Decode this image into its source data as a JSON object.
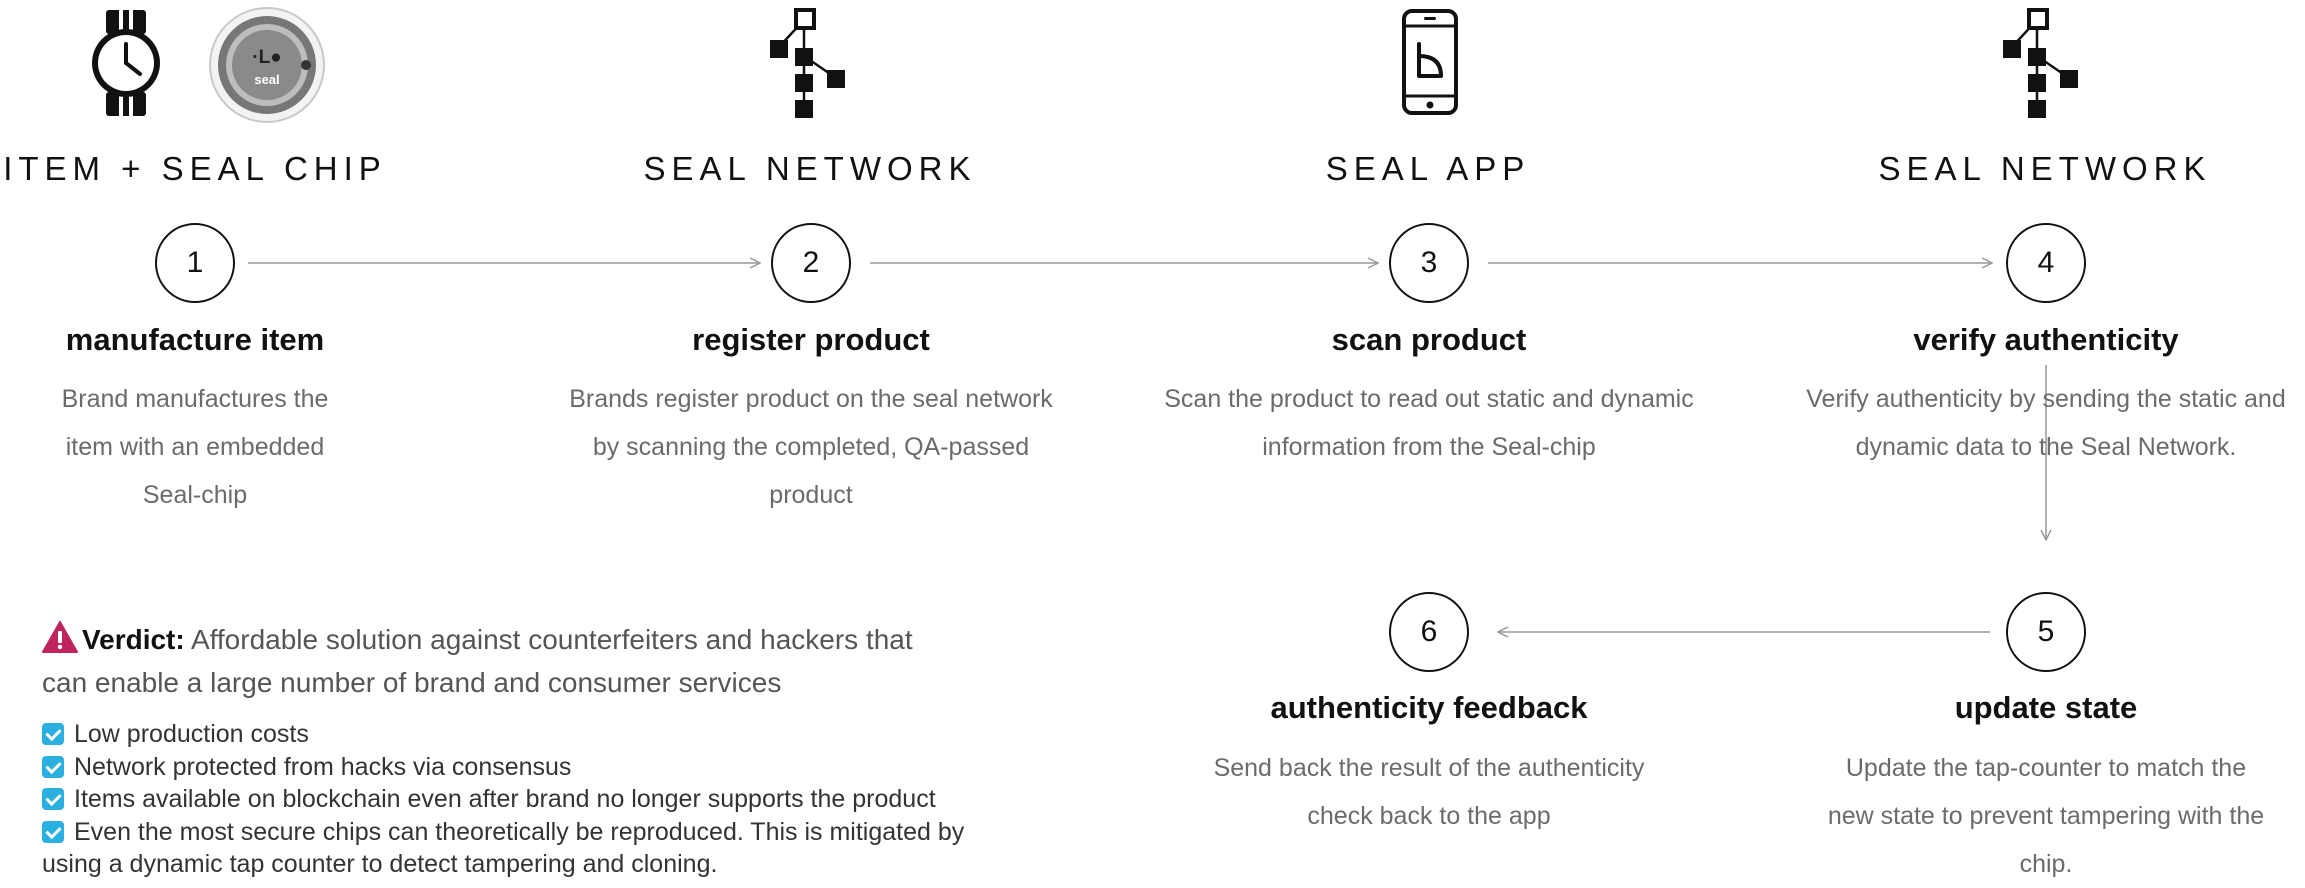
{
  "headers": [
    "ITEM + SEAL CHIP",
    "SEAL NETWORK",
    "SEAL APP",
    "SEAL NETWORK"
  ],
  "seal_logo_text": "seal",
  "steps": [
    {
      "number": "1",
      "title": "manufacture item",
      "desc": "Brand manufactures the item with an embedded Seal-chip"
    },
    {
      "number": "2",
      "title": "register product",
      "desc": "Brands register product on the seal network by scanning the completed, QA-passed product"
    },
    {
      "number": "3",
      "title": "scan product",
      "desc": "Scan the product to read out static and dynamic information from the Seal-chip"
    },
    {
      "number": "4",
      "title": "verify authenticity",
      "desc": "Verify authenticity by sending the static and dynamic data to the Seal Network."
    },
    {
      "number": "5",
      "title": "update state",
      "desc": "Update the tap-counter to match the new state to prevent tampering with the chip."
    },
    {
      "number": "6",
      "title": "authenticity feedback",
      "desc": "Send back the result of the authenticity check back to the app"
    }
  ],
  "verdict": {
    "label": "Verdict:",
    "text": " Affordable solution against counterfeiters and hackers that can enable a large number of brand and consumer services"
  },
  "benefits": [
    "Low production costs",
    "Network protected from hacks via consensus",
    "Items available on blockchain even after brand no longer supports the product",
    "Even the most secure chips can theoretically be reproduced. This is mitigated by using a dynamic tap counter to detect tampering and cloning."
  ],
  "colors": {
    "accent_check": "#2bafe0",
    "warning": "#c0245f",
    "connector": "#999999",
    "desc_text": "#6b6b6b"
  }
}
